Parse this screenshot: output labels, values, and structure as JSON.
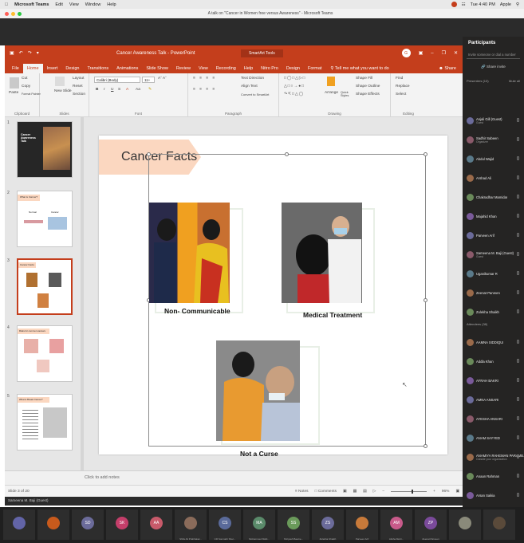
{
  "menubar": {
    "app": "Microsoft Teams",
    "items": [
      "Edit",
      "View",
      "Window",
      "Help"
    ],
    "clock": "Tue 4:40 PM",
    "user": "Apple"
  },
  "teams_title": "A talk on \"Cancer in Women free versus Awareness\" - Microsoft Teams",
  "ppt": {
    "title": "Cancer Awareness Talk - PowerPoint",
    "contextual_tab": "SmartArt Tools",
    "user_initials": "G",
    "tabs": [
      "File",
      "Home",
      "Insert",
      "Design",
      "Transitions",
      "Animations",
      "Slide Show",
      "Review",
      "View",
      "Recording",
      "Help",
      "Nitro Pro",
      "Design",
      "Format"
    ],
    "active_tab": "Home",
    "tell_me": "Tell me what you want to do",
    "share": "Share",
    "ribbon": {
      "clipboard": {
        "label": "Clipboard",
        "paste": "Paste",
        "cut": "Cut",
        "copy": "Copy",
        "format_painter": "Format Painter"
      },
      "slides": {
        "label": "Slides",
        "new_slide": "New Slide",
        "layout": "Layout",
        "reset": "Reset",
        "section": "Section"
      },
      "font": {
        "label": "Font",
        "font_name": "Calibri (Body)",
        "font_size": "11+"
      },
      "paragraph": {
        "label": "Paragraph",
        "text_direction": "Text Direction",
        "align_text": "Align Text",
        "smartart": "Convert to SmartArt"
      },
      "drawing": {
        "label": "Drawing",
        "arrange": "Arrange",
        "quick_styles": "Quick Styles",
        "shape_fill": "Shape Fill",
        "shape_outline": "Shape Outline",
        "shape_effects": "Shape Effects"
      },
      "editing": {
        "label": "Editing",
        "find": "Find",
        "replace": "Replace",
        "select": "Select"
      }
    },
    "thumbnails": [
      {
        "num": "1",
        "title": "Cancer Awareness Talk"
      },
      {
        "num": "2",
        "title": "What is Cancer?",
        "sub1": "Normal",
        "sub2": "Cancer"
      },
      {
        "num": "3",
        "title": "Cancer Facts"
      },
      {
        "num": "4",
        "title": "Risks for common cancers"
      },
      {
        "num": "5",
        "title": "What is Breast Cancer?"
      }
    ],
    "slide": {
      "title": "Cancer Facts",
      "captions": [
        "Non- Communicable",
        "Medical Treatment",
        "Not a Curse"
      ]
    },
    "notes_placeholder": "Click to add notes",
    "status": {
      "slide_of": "Slide 3 of 20",
      "notes": "Notes",
      "comments": "Comments",
      "zoom": "96%"
    },
    "presenter": "Sameena M. Baji (Guest)"
  },
  "participants": {
    "title": "Participants",
    "invite_placeholder": "Invite someone or dial a number",
    "share_invite": "Share invite",
    "presenters_label": "Presenters (13)",
    "mute_all": "Mute all",
    "attendees_label": "Attendees (38)",
    "presenters": [
      {
        "name": "Anjali Gill (Guest)",
        "sub": "Guest"
      },
      {
        "name": "Sadhir Sabeen",
        "sub": "Organizer"
      },
      {
        "name": "Abdul Wajid",
        "sub": ""
      },
      {
        "name": "Arshad Ali",
        "sub": ""
      },
      {
        "name": "Chakradhar Mamidar",
        "sub": ""
      },
      {
        "name": "Majahid Khan",
        "sub": ""
      },
      {
        "name": "Parveen Arif",
        "sub": ""
      },
      {
        "name": "Sameena M. Baji (Guest)",
        "sub": "Guest"
      },
      {
        "name": "Uganikumar R",
        "sub": ""
      },
      {
        "name": "Zeenat Parveen",
        "sub": ""
      },
      {
        "name": "Zulekha Shaikh",
        "sub": ""
      }
    ],
    "attendees": [
      {
        "name": "AAMNA SIDDIQUI",
        "sub": ""
      },
      {
        "name": "Addla Khan",
        "sub": ""
      },
      {
        "name": "AFRAH BAKRI",
        "sub": ""
      },
      {
        "name": "AMNA ANSARI",
        "sub": ""
      },
      {
        "name": "AYESHA ANSARI",
        "sub": ""
      },
      {
        "name": "ANAM SAYYED",
        "sub": ""
      },
      {
        "name": "ANAMIYA RAHEMAN PARAMB...",
        "sub": "Outside your organization"
      },
      {
        "name": "Anaan Rahman",
        "sub": ""
      },
      {
        "name": "Arsan Saikia",
        "sub": ""
      },
      {
        "name": "Asif Khan",
        "sub": ""
      },
      {
        "name": "AYESHA KHAN",
        "sub": ""
      }
    ]
  },
  "gallery": [
    {
      "initials": "",
      "color": "#6264a7",
      "name": ""
    },
    {
      "initials": "",
      "color": "#c85a1c",
      "name": ""
    },
    {
      "initials": "SD",
      "color": "#6b6b9a",
      "name": ""
    },
    {
      "initials": "SK",
      "color": "#c43e6a",
      "name": ""
    },
    {
      "initials": "AA",
      "color": "#c85a6a",
      "name": ""
    },
    {
      "initials": "",
      "color": "#8a6b5a",
      "name": "Shifa Ali Prabhakar..."
    },
    {
      "initials": "CS",
      "color": "#5a6a9a",
      "name": "CR Somnath Sher..."
    },
    {
      "initials": "MA",
      "color": "#5a8a6a",
      "name": "Mohammed Mahi..."
    },
    {
      "initials": "SS",
      "color": "#6a9a5a",
      "name": "Shriyash Bawne..."
    },
    {
      "initials": "ZS",
      "color": "#6b6b9a",
      "name": "Zulekha Shaikh"
    },
    {
      "initials": "",
      "color": "#c87a3a",
      "name": "Parveen Arif"
    },
    {
      "initials": "AM",
      "color": "#c85a8a",
      "name": "Alisha Mehr..."
    },
    {
      "initials": "ZP",
      "color": "#7a4a9a",
      "name": "Zeenat Parveen"
    },
    {
      "initials": "",
      "color": "#8a8a7a",
      "name": ""
    },
    {
      "initials": "",
      "color": "#5a4a3a",
      "name": ""
    }
  ],
  "colors": {
    "ppt_accent": "#c43e1c",
    "banner": "#fbd7c0",
    "teams_dark": "#252423"
  }
}
